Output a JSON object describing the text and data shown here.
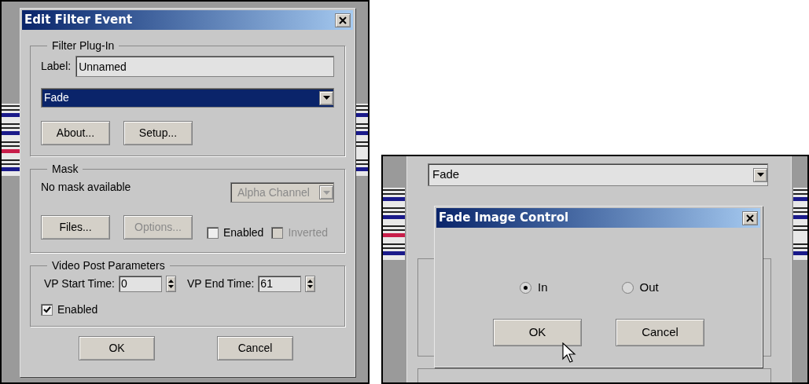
{
  "edit_filter_event": {
    "title": "Edit Filter Event",
    "filter_plugin": {
      "legend": "Filter Plug-In",
      "label_caption": "Label:",
      "label_value": "Unnamed",
      "plugin": "Fade",
      "plugin_focused": true,
      "buttons": [
        "About...",
        "Setup..."
      ]
    },
    "mask": {
      "legend": "Mask",
      "status": "No mask available",
      "channel": "Alpha Channel",
      "channel_disabled": true,
      "buttons": [
        {
          "label": "Files...",
          "disabled": false
        },
        {
          "label": "Options...",
          "disabled": true
        }
      ],
      "checkboxes": [
        {
          "label": "Enabled",
          "checked": false,
          "disabled": false
        },
        {
          "label": "Inverted",
          "checked": false,
          "disabled": true
        }
      ]
    },
    "video_post": {
      "legend": "Video Post Parameters",
      "fields": [
        {
          "label": "VP Start Time:",
          "value": "0"
        },
        {
          "label": "VP End Time:",
          "value": "61"
        }
      ],
      "enabled": {
        "label": "Enabled",
        "checked": true
      }
    },
    "buttons": [
      "OK",
      "Cancel"
    ]
  },
  "fade_image_control": {
    "background_plugin": "Fade",
    "title": "Fade Image Control",
    "options": [
      {
        "label": "In",
        "selected": true
      },
      {
        "label": "Out",
        "selected": false
      }
    ],
    "buttons": [
      "OK",
      "Cancel"
    ]
  }
}
